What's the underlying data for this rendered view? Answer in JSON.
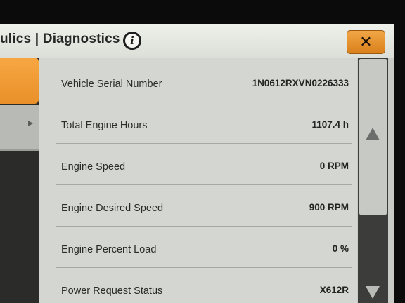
{
  "header": {
    "title": "ulics | Diagnostics",
    "info_icon": "i",
    "close_icon": "✕"
  },
  "colors": {
    "accent_orange": "#f0a03a",
    "panel_bg": "#d4d7d1",
    "header_bg": "#e6e8e2",
    "scrollbar_bg": "#3c3d3b"
  },
  "rows": [
    {
      "label": "Vehicle Serial Number",
      "value": "1N0612RXVN0226333"
    },
    {
      "label": "Total Engine Hours",
      "value": "1107.4 h"
    },
    {
      "label": "Engine Speed",
      "value": "0 RPM"
    },
    {
      "label": "Engine Desired Speed",
      "value": "900 RPM"
    },
    {
      "label": "Engine Percent Load",
      "value": "0 %"
    },
    {
      "label": "Power Request Status",
      "value": "X612R"
    }
  ],
  "scroll": {
    "up_icon": "triangle-up-icon",
    "down_icon": "triangle-down-icon"
  }
}
